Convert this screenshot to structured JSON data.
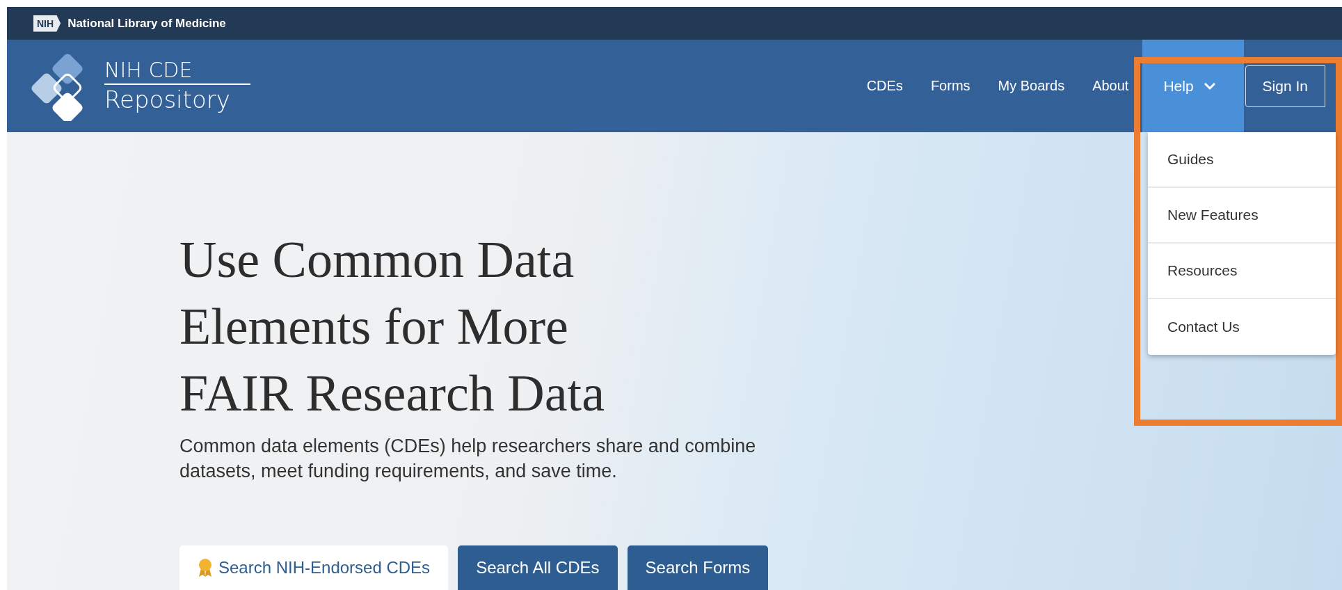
{
  "top_bar": {
    "badge": "NIH",
    "title": "National Library of Medicine"
  },
  "header": {
    "logo_line_1": "NIH CDE",
    "logo_line_2": "Repository",
    "nav": [
      {
        "label": "CDEs",
        "kind": "link"
      },
      {
        "label": "Forms",
        "kind": "link"
      },
      {
        "label": "My Boards",
        "kind": "link"
      },
      {
        "label": "About",
        "kind": "link"
      },
      {
        "label": "Help",
        "kind": "menu",
        "expanded": true
      },
      {
        "label": "Sign In",
        "kind": "button"
      }
    ]
  },
  "help_menu": [
    "Guides",
    "New Features",
    "Resources",
    "Contact Us"
  ],
  "hero": {
    "heading": [
      "Use Common Data",
      "Elements for More",
      "FAIR Research Data"
    ],
    "text": "Common data elements (CDEs) help researchers share and combine datasets, meet funding requirements, and save time."
  },
  "search_tabs": [
    {
      "label": "Search NIH-Endorsed CDEs",
      "selected": true,
      "kind": "endorsed"
    },
    {
      "label": "Search All CDEs",
      "selected": false,
      "kind": "plain"
    },
    {
      "label": "Search Forms",
      "selected": false,
      "kind": "plain"
    }
  ]
}
